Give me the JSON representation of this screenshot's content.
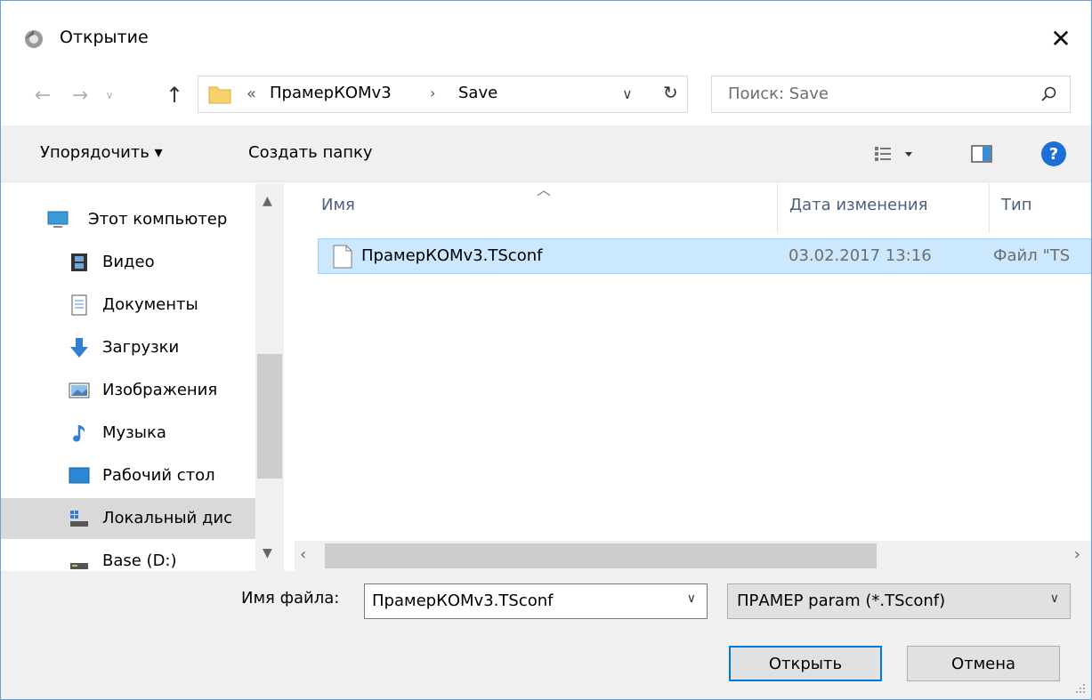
{
  "window": {
    "title": "Открытие",
    "close_label": "✕"
  },
  "nav": {
    "back": "←",
    "forward": "→",
    "recent": "∨",
    "up": "↑"
  },
  "address": {
    "overflow": "«",
    "segments": [
      "ПрамерКОМv3",
      "Save"
    ],
    "separator": "›",
    "dropdown": "∨",
    "refresh": "↻"
  },
  "search": {
    "placeholder": "Поиск: Save"
  },
  "toolbar": {
    "organize": "Упорядочить ▾",
    "new_folder": "Создать папку",
    "help": "?"
  },
  "sidebar": {
    "items": [
      {
        "label": "Этот компьютер",
        "icon": "computer-icon"
      },
      {
        "label": "Видео",
        "icon": "video-icon"
      },
      {
        "label": "Документы",
        "icon": "documents-icon"
      },
      {
        "label": "Загрузки",
        "icon": "downloads-icon"
      },
      {
        "label": "Изображения",
        "icon": "pictures-icon"
      },
      {
        "label": "Музыка",
        "icon": "music-icon"
      },
      {
        "label": "Рабочий стол",
        "icon": "desktop-icon"
      },
      {
        "label": "Локальный дис",
        "icon": "local-disk-icon",
        "selected": true
      },
      {
        "label": "Base (D:)",
        "icon": "drive-icon"
      }
    ]
  },
  "filelist": {
    "columns": [
      "Имя",
      "Дата изменения",
      "Тип"
    ],
    "rows": [
      {
        "name": "ПрамерКОМv3.TSconf",
        "date": "03.02.2017 13:16",
        "type": "Файл \"TS"
      }
    ]
  },
  "bottom": {
    "filename_label": "Имя файла:",
    "filename_value": "ПрамерКОМv3.TSconf",
    "filter_value": "ПРАМЕР param (*.TSconf)",
    "open_button": "Открыть",
    "cancel_button": "Отмена"
  },
  "colors": {
    "accent": "#0078d7",
    "selection": "#cce8ff",
    "help": "#1d6fd8"
  }
}
